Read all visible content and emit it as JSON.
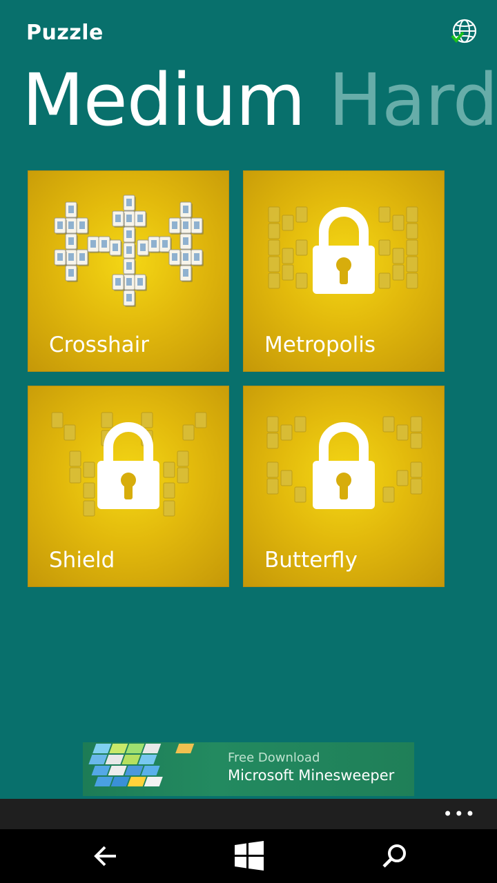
{
  "header": {
    "app_title": "Puzzle",
    "sync_icon": "globe-check-icon"
  },
  "pivot": {
    "active": "Medium",
    "inactive": "Hard"
  },
  "tiles": [
    {
      "label": "Crosshair",
      "locked": false
    },
    {
      "label": "Metropolis",
      "locked": true
    },
    {
      "label": "Shield",
      "locked": true
    },
    {
      "label": "Butterfly",
      "locked": true
    }
  ],
  "ad": {
    "line1": "Free Download",
    "line2": "Microsoft Minesweeper"
  },
  "app_bar": {
    "more_label": "•••"
  },
  "nav": {
    "back_icon": "back-arrow-icon",
    "home_icon": "windows-logo-icon",
    "search_icon": "search-icon"
  },
  "colors": {
    "background": "#08706c",
    "tile_gold": "#e2b90c",
    "pivot_inactive": "#67ada9"
  }
}
